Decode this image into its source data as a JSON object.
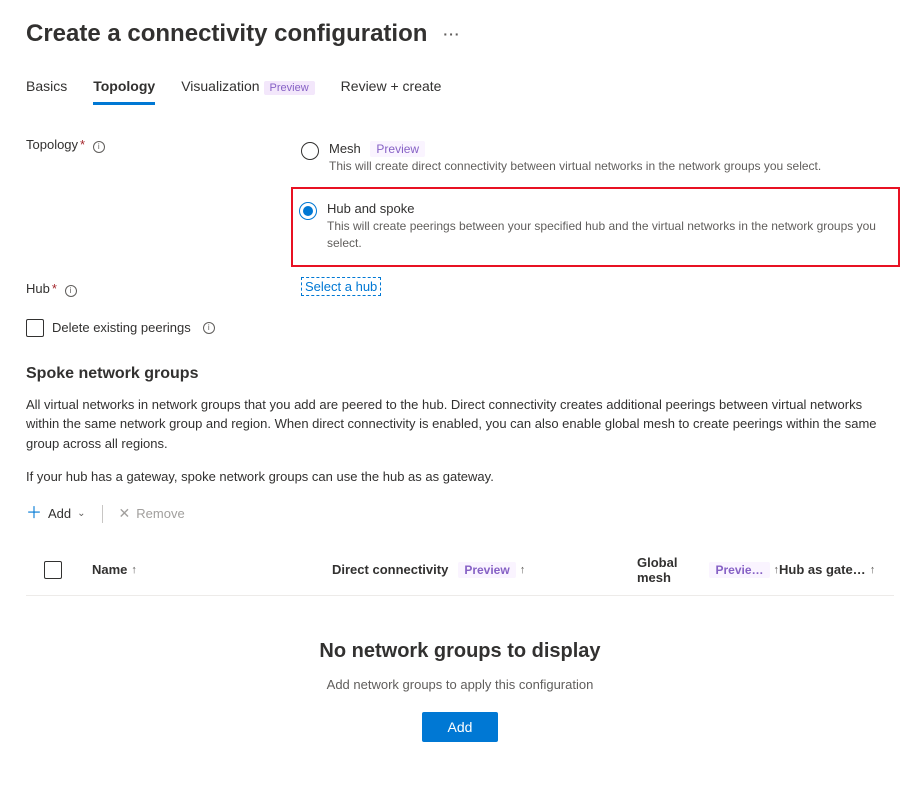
{
  "page_title": "Create a connectivity configuration",
  "tabs": [
    {
      "label": "Basics",
      "active": false,
      "preview": false
    },
    {
      "label": "Topology",
      "active": true,
      "preview": false
    },
    {
      "label": "Visualization",
      "active": false,
      "preview": true
    },
    {
      "label": "Review + create",
      "active": false,
      "preview": false
    }
  ],
  "preview_label": "Preview",
  "preview_short": "Previe…",
  "topology": {
    "label": "Topology",
    "mesh": {
      "label": "Mesh",
      "desc": "This will create direct connectivity between virtual networks in the network groups you select."
    },
    "hub": {
      "label": "Hub and spoke",
      "desc": "This will create peerings between your specified hub and the virtual networks in the network groups you select."
    }
  },
  "hub": {
    "label": "Hub",
    "select_link": "Select a hub"
  },
  "delete_peerings_label": "Delete existing peerings",
  "spoke": {
    "heading": "Spoke network groups",
    "desc1": "All virtual networks in network groups that you add are peered to the hub. Direct connectivity creates additional peerings between virtual networks within the same network group and region. When direct connectivity is enabled, you can also enable global mesh to create peerings within the same group across all regions.",
    "desc2": "If your hub has a gateway, spoke network groups can use the hub as as gateway."
  },
  "toolbar": {
    "add": "Add",
    "remove": "Remove"
  },
  "table": {
    "cols": {
      "name": "Name",
      "direct": "Direct connectivity",
      "global": "Global mesh",
      "hubgw": "Hub as gate…"
    }
  },
  "empty": {
    "title": "No network groups to display",
    "sub": "Add network groups to apply this configuration",
    "btn": "Add"
  }
}
